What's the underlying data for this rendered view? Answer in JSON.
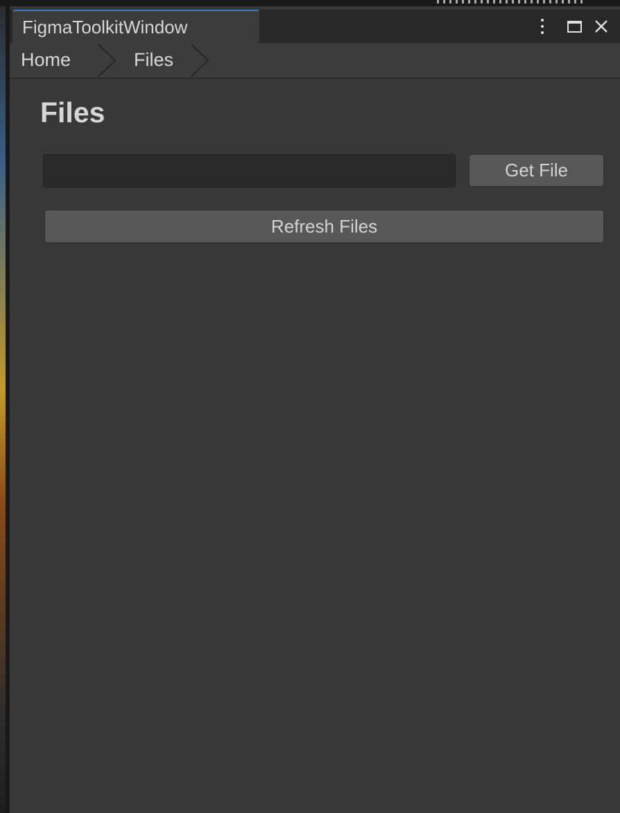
{
  "window": {
    "tab_title": "FigmaToolkitWindow",
    "controls": {
      "menu_icon": "kebab-menu-icon",
      "maximize_icon": "maximize-icon",
      "close_icon": "close-icon",
      "close_glyph": "✕"
    }
  },
  "breadcrumb": {
    "items": [
      {
        "label": "Home"
      },
      {
        "label": "Files"
      }
    ],
    "separator_icon": "chevron-right-icon"
  },
  "main": {
    "title": "Files",
    "file_input": {
      "value": "",
      "placeholder": ""
    },
    "get_file_label": "Get File",
    "refresh_files_label": "Refresh Files"
  },
  "colors": {
    "background": "#383838",
    "tab_bar": "#282828",
    "active_tab": "#3c3c3c",
    "tab_accent": "#3b79c2",
    "button": "#585858",
    "input": "#2a2a2a",
    "text": "#d6d6d6"
  }
}
